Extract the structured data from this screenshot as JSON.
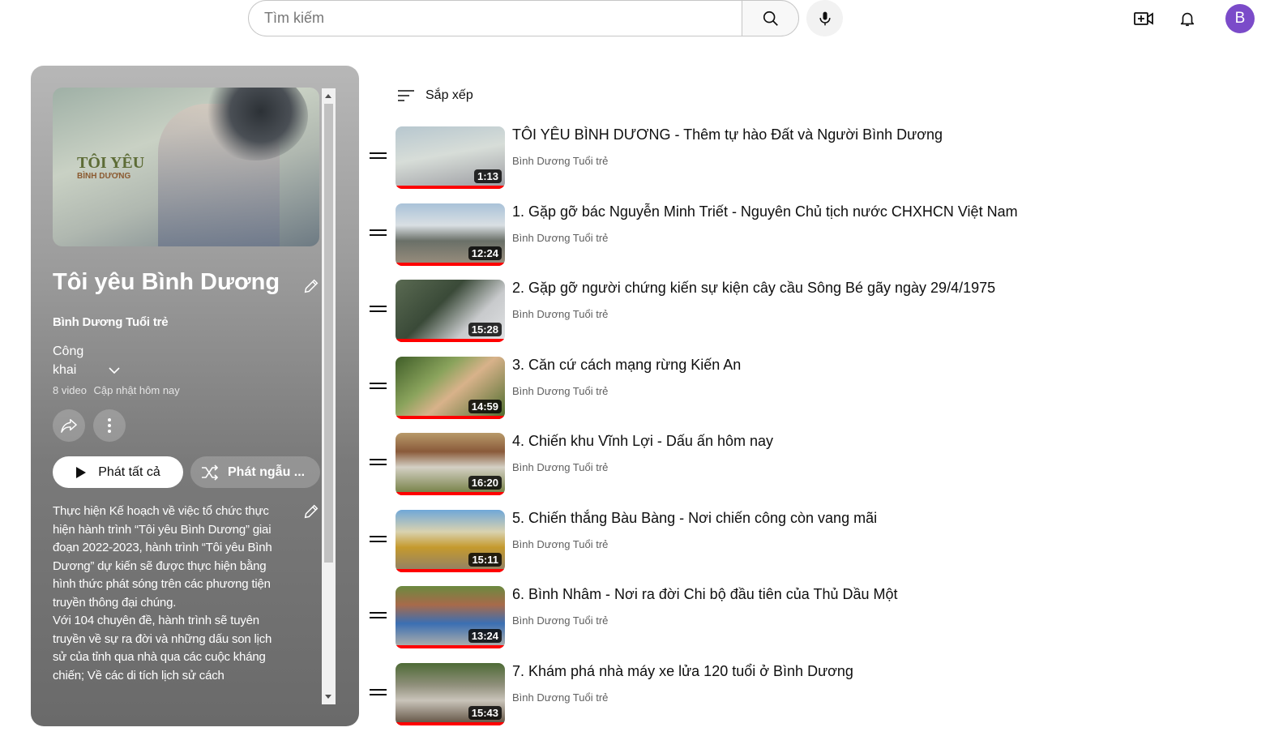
{
  "search": {
    "placeholder": "Tìm kiếm"
  },
  "user": {
    "avatar_letter": "B",
    "avatar_color": "#7b4bc9"
  },
  "playlist": {
    "cover_logo_line1": "TÔI YÊU",
    "cover_logo_line2": "BÌNH DƯƠNG",
    "title": "Tôi yêu Bình Dương",
    "owner": "Bình Dương Tuổi trẻ",
    "privacy": "Công khai",
    "video_count": "8 video",
    "updated": "Cập nhật hôm nay",
    "play_all": "Phát tất cả",
    "shuffle": "Phát ngẫu ...",
    "description": [
      "Thực hiện Kế hoạch về việc tổ chức thực hiện hành trình “Tôi yêu Bình Dương” giai đoạn 2022-2023, hành trình “Tôi yêu Bình Dương” dự kiến sẽ được thực hiện bằng hình thức phát sóng trên các phương tiện truyền thông đại chúng.",
      "Với 104 chuyên đề, hành trình sẽ tuyên truyền về sự ra đời và những dấu son lịch sử của tỉnh qua nhà qua các cuộc kháng chiến; Về các di tích lịch sử cách"
    ]
  },
  "sort_label": "Sắp xếp",
  "accent_color": "#ff0000",
  "videos": [
    {
      "title": "TÔI YÊU BÌNH DƯƠNG - Thêm tự hào Đất và Người Bình Dương",
      "owner": "Bình Dương Tuổi trẻ",
      "duration": "1:13"
    },
    {
      "title": "1. Gặp gỡ bác Nguyễn Minh Triết - Nguyên Chủ tịch nước CHXHCN Việt Nam",
      "owner": "Bình Dương Tuổi trẻ",
      "duration": "12:24"
    },
    {
      "title": "2. Gặp gỡ người chứng kiến sự kiện cây cầu Sông Bé gãy ngày 29/4/1975",
      "owner": "Bình Dương Tuổi trẻ",
      "duration": "15:28"
    },
    {
      "title": "3. Căn cứ cách mạng rừng Kiến An",
      "owner": "Bình Dương Tuổi trẻ",
      "duration": "14:59"
    },
    {
      "title": "4. Chiến khu Vĩnh Lợi - Dấu ấn hôm nay",
      "owner": "Bình Dương Tuổi trẻ",
      "duration": "16:20"
    },
    {
      "title": "5. Chiến thắng Bàu Bàng - Nơi chiến công còn vang mãi",
      "owner": "Bình Dương Tuổi trẻ",
      "duration": "15:11"
    },
    {
      "title": "6. Bình Nhâm - Nơi ra đời Chi bộ đầu tiên của Thủ Dầu Một",
      "owner": "Bình Dương Tuổi trẻ",
      "duration": "13:24"
    },
    {
      "title": "7. Khám phá nhà máy xe lửa 120 tuổi ở Bình Dương",
      "owner": "Bình Dương Tuổi trẻ",
      "duration": "15:43"
    }
  ]
}
